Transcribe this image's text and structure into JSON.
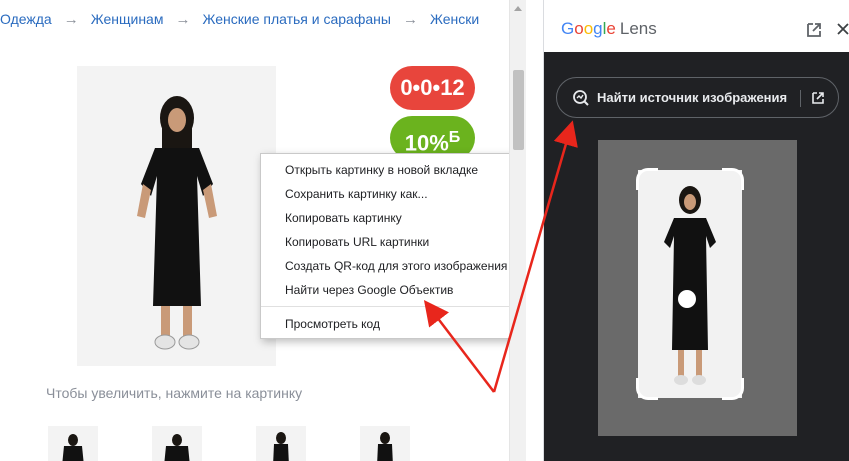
{
  "breadcrumb": {
    "items": [
      "Одежда",
      "Женщинам",
      "Женские платья и сарафаны",
      "Женски"
    ],
    "separator": "→"
  },
  "product": {
    "badge_top": "0•0•12",
    "badge_bottom": "10%",
    "badge_bottom_suffix": "Б",
    "zoom_hint": "Чтобы увеличить, нажмите на картинку",
    "image_icon": "woman-black-dress-photo"
  },
  "context_menu": {
    "items": [
      "Открыть картинку в новой вкладке",
      "Сохранить картинку как...",
      "Копировать картинку",
      "Копировать URL картинки",
      "Создать QR-код для этого изображения",
      "Найти через Google Объектив",
      "Просмотреть код"
    ]
  },
  "lens": {
    "logo_google": [
      "G",
      "o",
      "o",
      "g",
      "l",
      "e"
    ],
    "logo_suffix": "Lens",
    "find_source_label": "Найти источник изображения",
    "open_icon": "open-in-new-icon",
    "close_icon": "close-icon",
    "lens_icon": "image-search-icon"
  },
  "colors": {
    "link": "#2a6bbf",
    "badge_red": "#e8453c",
    "badge_green": "#6bb31e",
    "lens_bg": "#202124",
    "annotation_arrow": "#e8261c"
  }
}
